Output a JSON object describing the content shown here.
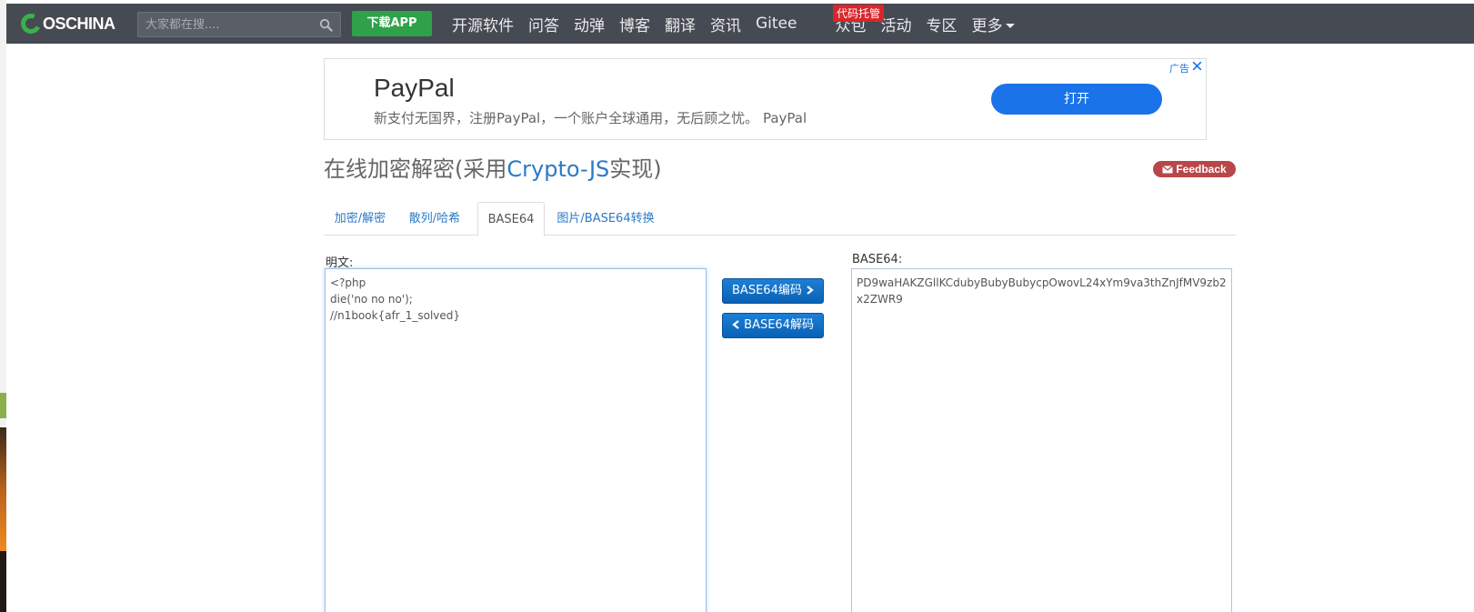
{
  "colors": {
    "nav_bg": "#464a52",
    "brand_green": "#37b34a",
    "link_blue": "#2a7ac7",
    "ad_blue": "#1a73e8",
    "badge_red": "#d9262c",
    "feedback_red": "#b9464a",
    "button_blue": "#0961b5"
  },
  "topnav": {
    "logo_text": "OSCHINA",
    "search_placeholder": "大家都在搜....",
    "download_label": "下载APP",
    "links": [
      "开源软件",
      "问答",
      "动弹",
      "博客",
      "翻译",
      "资讯",
      "Gitee",
      "众包",
      "活动",
      "专区"
    ],
    "more_label": "更多",
    "gitee_badge": "代码托管"
  },
  "ad": {
    "title": "PayPal",
    "description": "新支付无国界，注册PayPal，一个账户全球通用，无后顾之忧。 PayPal",
    "open_button": "打开",
    "label": "广告"
  },
  "page": {
    "title_prefix": "在线加密解密(采用",
    "title_highlight": "Crypto-JS",
    "title_suffix": "实现)",
    "feedback_label": "Feedback"
  },
  "tabs": [
    "加密/解密",
    "散列/哈希",
    "BASE64",
    "图片/BASE64转换"
  ],
  "active_tab": "BASE64",
  "form": {
    "plain_label": "明文:",
    "plain_value": "<?php\ndie('no no no');\n//n1book{afr_1_solved}",
    "encode_button": "BASE64编码",
    "decode_button": "BASE64解码",
    "base64_label": "BASE64:",
    "base64_value": "PD9waHAKZGllKCdubyBubyBubycpOwovL24xYm9va3thZnJfMV9zb2x2ZWR9"
  }
}
